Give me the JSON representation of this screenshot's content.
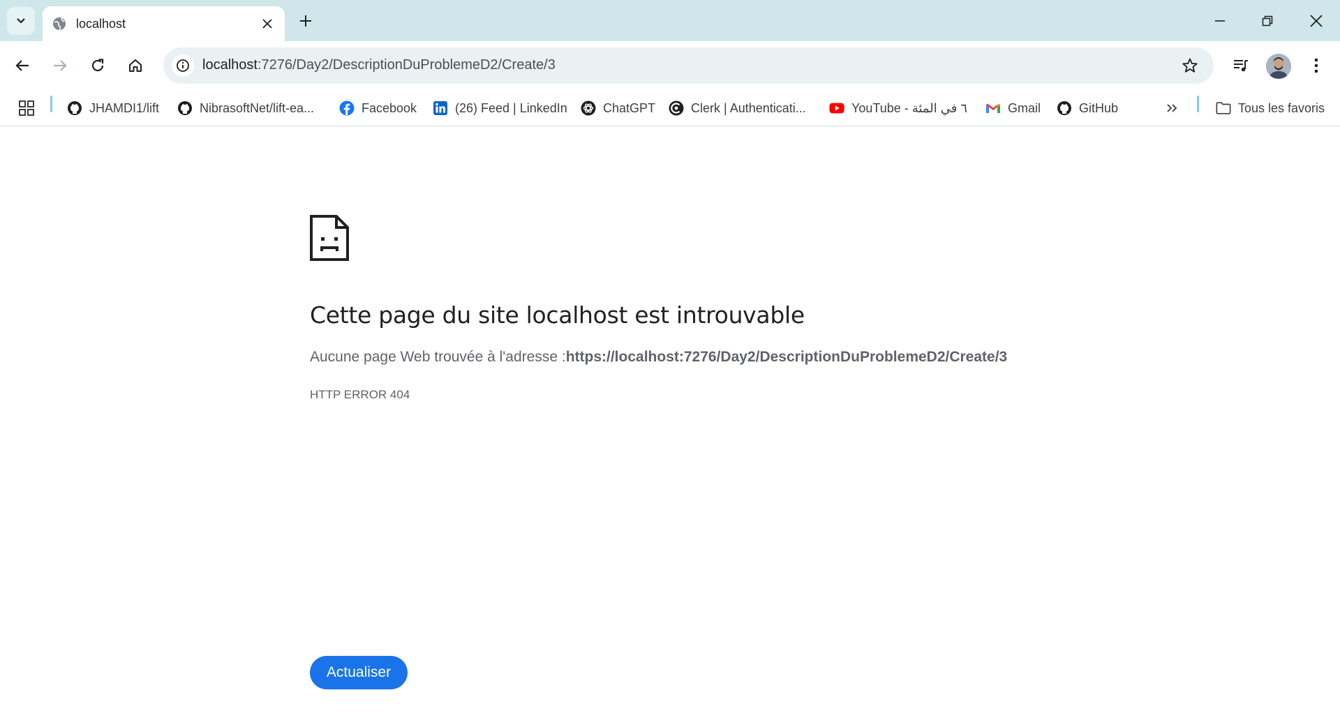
{
  "browser": {
    "tab": {
      "title": "localhost"
    },
    "address_bar": {
      "host": "localhost",
      "path": ":7276/Day2/DescriptionDuProblemeD2/Create/3"
    },
    "bookmarks": [
      {
        "label": "JHAMDI1/lift",
        "icon": "github-icon"
      },
      {
        "label": "NibrasoftNet/lift-ea...",
        "icon": "github-icon"
      },
      {
        "label": "Facebook",
        "icon": "facebook-icon"
      },
      {
        "label": "(26) Feed | LinkedIn",
        "icon": "linkedin-icon"
      },
      {
        "label": "ChatGPT",
        "icon": "chatgpt-icon"
      },
      {
        "label": "Clerk | Authenticati...",
        "icon": "clerk-icon"
      },
      {
        "label": "YouTube - ٦ في المئة",
        "icon": "youtube-icon"
      },
      {
        "label": "Gmail",
        "icon": "gmail-icon"
      },
      {
        "label": "GitHub",
        "icon": "github-icon"
      }
    ],
    "all_bookmarks_label": "Tous les favoris"
  },
  "error_page": {
    "title": "Cette page du site localhost est introuvable",
    "message_prefix": "Aucune page Web trouvée à l'adresse :",
    "message_url": "https://localhost:7276/Day2/DescriptionDuProblemeD2/Create/3",
    "error_code": "HTTP ERROR 404",
    "reload_button": "Actualiser"
  },
  "colors": {
    "tabstrip": "#cfe6ea",
    "omnibox": "#e9f1f3",
    "primary_button": "#1a73e8"
  }
}
